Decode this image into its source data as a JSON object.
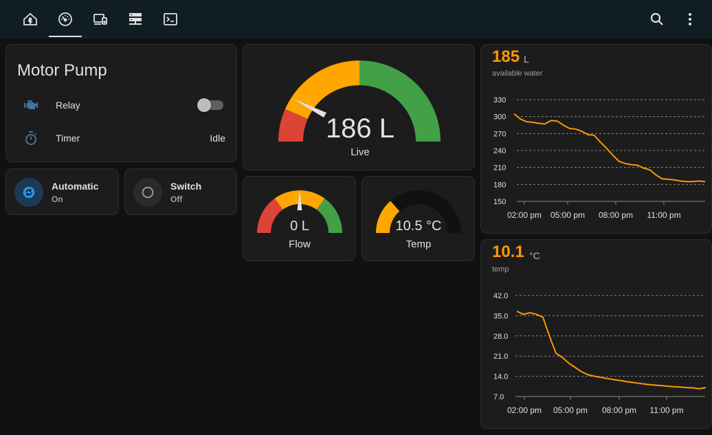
{
  "topbar": {
    "tabs": [
      {
        "icon": "home-assistant-icon",
        "active": false
      },
      {
        "icon": "speedometer-icon",
        "active": true
      },
      {
        "icon": "devices-icon",
        "active": false
      },
      {
        "icon": "server-icon",
        "active": false
      },
      {
        "icon": "terminal-icon",
        "active": false
      }
    ],
    "actions": [
      "search-icon",
      "more-vertical-icon"
    ]
  },
  "motor_card": {
    "title": "Motor Pump",
    "rows": [
      {
        "icon": "engine-icon",
        "label": "Relay",
        "type": "toggle",
        "on": false
      },
      {
        "icon": "timer-icon",
        "label": "Timer",
        "value": "Idle"
      }
    ]
  },
  "tiles": [
    {
      "name": "Automatic",
      "state": "On",
      "icon": "autorenew-icon",
      "color": "#2196f3"
    },
    {
      "name": "Switch",
      "state": "Off",
      "icon": "circle-outline-icon",
      "color": "#9e9e9e"
    }
  ],
  "gauges": {
    "live": {
      "value": "186 L",
      "name": "Live"
    },
    "flow": {
      "value": "0 L",
      "name": "Flow"
    },
    "temp": {
      "value": "10.5 °C",
      "name": "Temp"
    }
  },
  "colors": {
    "red": "#db4437",
    "amber": "#ffa600",
    "green": "#43a047",
    "accent": "#ff9800"
  },
  "sensor_water": {
    "value": "185",
    "unit": "L",
    "name": "available water",
    "chart_data": {
      "type": "line",
      "y_ticks": [
        "330",
        "300",
        "270",
        "240",
        "210",
        "180",
        "150"
      ],
      "ylim": [
        150,
        330
      ],
      "x_ticks": [
        "02:00 pm",
        "05:00 pm",
        "08:00 pm",
        "11:00 pm"
      ],
      "series": [
        {
          "values": [
            305,
            296,
            291,
            290,
            288,
            287,
            293,
            292,
            285,
            279,
            278,
            274,
            268,
            267,
            255,
            244,
            232,
            221,
            217,
            215,
            214,
            209,
            206,
            197,
            190,
            189,
            188,
            186,
            185,
            185,
            186,
            185
          ]
        }
      ]
    }
  },
  "sensor_temp": {
    "value": "10.1",
    "unit": "°C",
    "name": "temp",
    "chart_data": {
      "type": "line",
      "y_ticks": [
        "42.0",
        "35.0",
        "28.0",
        "21.0",
        "14.0",
        "7.0"
      ],
      "ylim": [
        7,
        42
      ],
      "x_ticks": [
        "02:00 pm",
        "05:00 pm",
        "08:00 pm",
        "11:00 pm"
      ],
      "series": [
        {
          "values": [
            36.5,
            35.5,
            36,
            35.5,
            34.5,
            28,
            22,
            20.5,
            18.5,
            17,
            15.5,
            14.5,
            14,
            13.6,
            13.2,
            12.8,
            12.5,
            12.1,
            11.8,
            11.5,
            11.2,
            11,
            10.8,
            10.6,
            10.4,
            10.3,
            10.1,
            10,
            9.7,
            10.1
          ]
        }
      ]
    }
  }
}
